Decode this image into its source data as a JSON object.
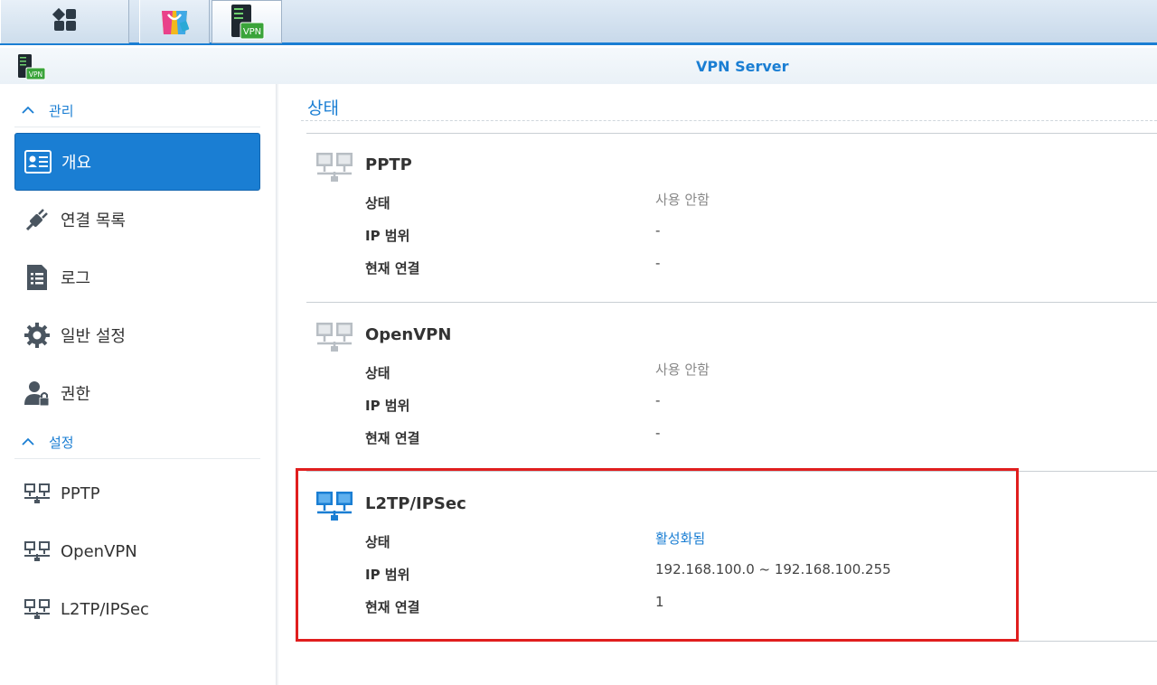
{
  "taskbar": {
    "main_menu_icon": "grid-icon",
    "package_center_icon": "shopping-bag-icon",
    "vpn_app_icon": "vpn-server-icon",
    "vpn_badge": "VPN"
  },
  "window": {
    "title": "VPN Server",
    "icon_badge": "VPN"
  },
  "sidebar": {
    "sections": [
      {
        "label": "관리"
      },
      {
        "label": "설정"
      }
    ],
    "items": [
      {
        "label": "개요",
        "icon": "overview-card-icon",
        "active": true
      },
      {
        "label": "연결 목록",
        "icon": "plug-icon"
      },
      {
        "label": "로그",
        "icon": "log-document-icon"
      },
      {
        "label": "일반 설정",
        "icon": "gear-icon"
      },
      {
        "label": "권한",
        "icon": "user-lock-icon"
      },
      {
        "label": "PPTP",
        "icon": "network-icon"
      },
      {
        "label": "OpenVPN",
        "icon": "network-icon"
      },
      {
        "label": "L2TP/IPSec",
        "icon": "network-icon"
      }
    ]
  },
  "main": {
    "heading": "상태",
    "panels": [
      {
        "title": "PPTP",
        "icon": "network-gray-icon",
        "rows": [
          {
            "label": "상태",
            "value": "사용 안함"
          },
          {
            "label": "IP 범위",
            "value": "-"
          },
          {
            "label": "현재 연결",
            "value": "-"
          }
        ]
      },
      {
        "title": "OpenVPN",
        "icon": "network-gray-icon",
        "rows": [
          {
            "label": "상태",
            "value": "사용 안함"
          },
          {
            "label": "IP 범위",
            "value": "-"
          },
          {
            "label": "현재 연결",
            "value": "-"
          }
        ]
      },
      {
        "title": "L2TP/IPSec",
        "icon": "network-blue-icon",
        "rows": [
          {
            "label": "상태",
            "value": "활성화됨"
          },
          {
            "label": "IP 범위",
            "value": "192.168.100.0 ~ 192.168.100.255"
          },
          {
            "label": "현재 연결",
            "value": "1"
          }
        ]
      }
    ]
  },
  "colors": {
    "accent": "#1a7ed3",
    "highlight_box": "#e01e1e",
    "muted_text": "#888888"
  }
}
